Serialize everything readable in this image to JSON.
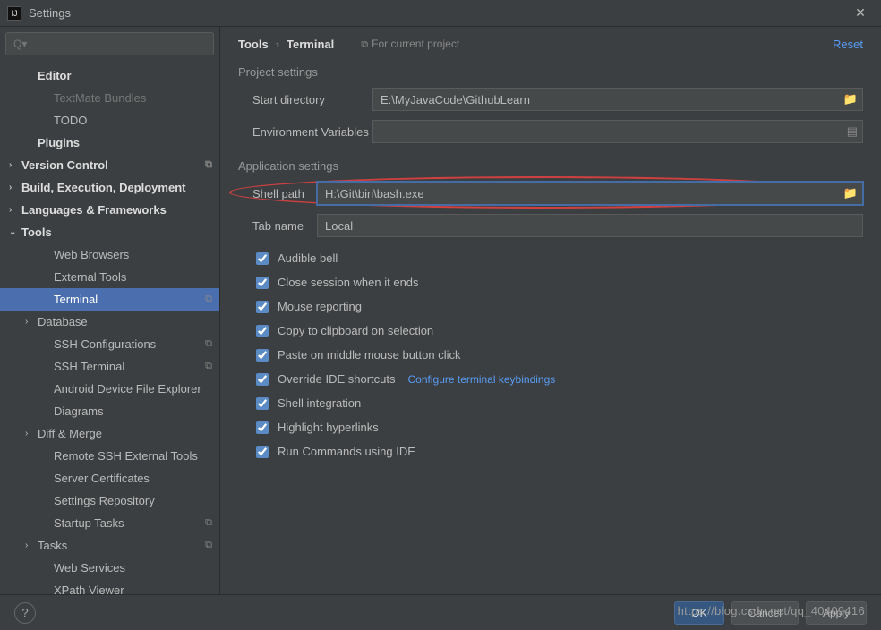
{
  "window": {
    "title": "Settings"
  },
  "search": {
    "placeholder": "Q▾"
  },
  "sidebar": {
    "items": [
      {
        "label": "Editor",
        "bold": true,
        "indent": 1,
        "chev": ""
      },
      {
        "label": "TextMate Bundles",
        "indent": 2,
        "chev": "",
        "dim": true
      },
      {
        "label": "TODO",
        "indent": 2,
        "chev": ""
      },
      {
        "label": "Plugins",
        "bold": true,
        "indent": 1,
        "chev": ""
      },
      {
        "label": "Version Control",
        "bold": true,
        "indent": 0,
        "chev": "›",
        "copy": true
      },
      {
        "label": "Build, Execution, Deployment",
        "bold": true,
        "indent": 0,
        "chev": "›"
      },
      {
        "label": "Languages & Frameworks",
        "bold": true,
        "indent": 0,
        "chev": "›"
      },
      {
        "label": "Tools",
        "bold": true,
        "indent": 0,
        "chev": "⌄"
      },
      {
        "label": "Web Browsers",
        "indent": 2,
        "chev": ""
      },
      {
        "label": "External Tools",
        "indent": 2,
        "chev": ""
      },
      {
        "label": "Terminal",
        "indent": 2,
        "chev": "",
        "selected": true,
        "copy": true
      },
      {
        "label": "Database",
        "indent": 1,
        "chev": "›"
      },
      {
        "label": "SSH Configurations",
        "indent": 2,
        "chev": "",
        "copy": true
      },
      {
        "label": "SSH Terminal",
        "indent": 2,
        "chev": "",
        "copy": true
      },
      {
        "label": "Android Device File Explorer",
        "indent": 2,
        "chev": ""
      },
      {
        "label": "Diagrams",
        "indent": 2,
        "chev": ""
      },
      {
        "label": "Diff & Merge",
        "indent": 1,
        "chev": "›"
      },
      {
        "label": "Remote SSH External Tools",
        "indent": 2,
        "chev": ""
      },
      {
        "label": "Server Certificates",
        "indent": 2,
        "chev": ""
      },
      {
        "label": "Settings Repository",
        "indent": 2,
        "chev": ""
      },
      {
        "label": "Startup Tasks",
        "indent": 2,
        "chev": "",
        "copy": true
      },
      {
        "label": "Tasks",
        "indent": 1,
        "chev": "›",
        "copy": true
      },
      {
        "label": "Web Services",
        "indent": 2,
        "chev": ""
      },
      {
        "label": "XPath Viewer",
        "indent": 2,
        "chev": ""
      }
    ]
  },
  "breadcrumb": {
    "root": "Tools",
    "current": "Terminal",
    "scope": "For current project",
    "reset": "Reset"
  },
  "sections": {
    "project": {
      "title": "Project settings",
      "start_dir_label": "Start directory",
      "start_dir_value": "E:\\MyJavaCode\\GithubLearn",
      "env_label": "Environment Variables",
      "env_value": ""
    },
    "app": {
      "title": "Application settings",
      "shell_path_label": "Shell path",
      "shell_path_value": "H:\\Git\\bin\\bash.exe",
      "tab_name_label": "Tab name",
      "tab_name_value": "Local",
      "checks": [
        {
          "label": "Audible bell"
        },
        {
          "label": "Close session when it ends"
        },
        {
          "label": "Mouse reporting"
        },
        {
          "label": "Copy to clipboard on selection"
        },
        {
          "label": "Paste on middle mouse button click"
        },
        {
          "label": "Override IDE shortcuts",
          "link": "Configure terminal keybindings"
        },
        {
          "label": "Shell integration"
        },
        {
          "label": "Highlight hyperlinks"
        },
        {
          "label": "Run Commands using IDE"
        }
      ]
    }
  },
  "footer": {
    "ok": "OK",
    "cancel": "Cancel",
    "apply": "Apply",
    "help": "?"
  },
  "watermark": "https://blog.csdn.net/qq_40409416"
}
